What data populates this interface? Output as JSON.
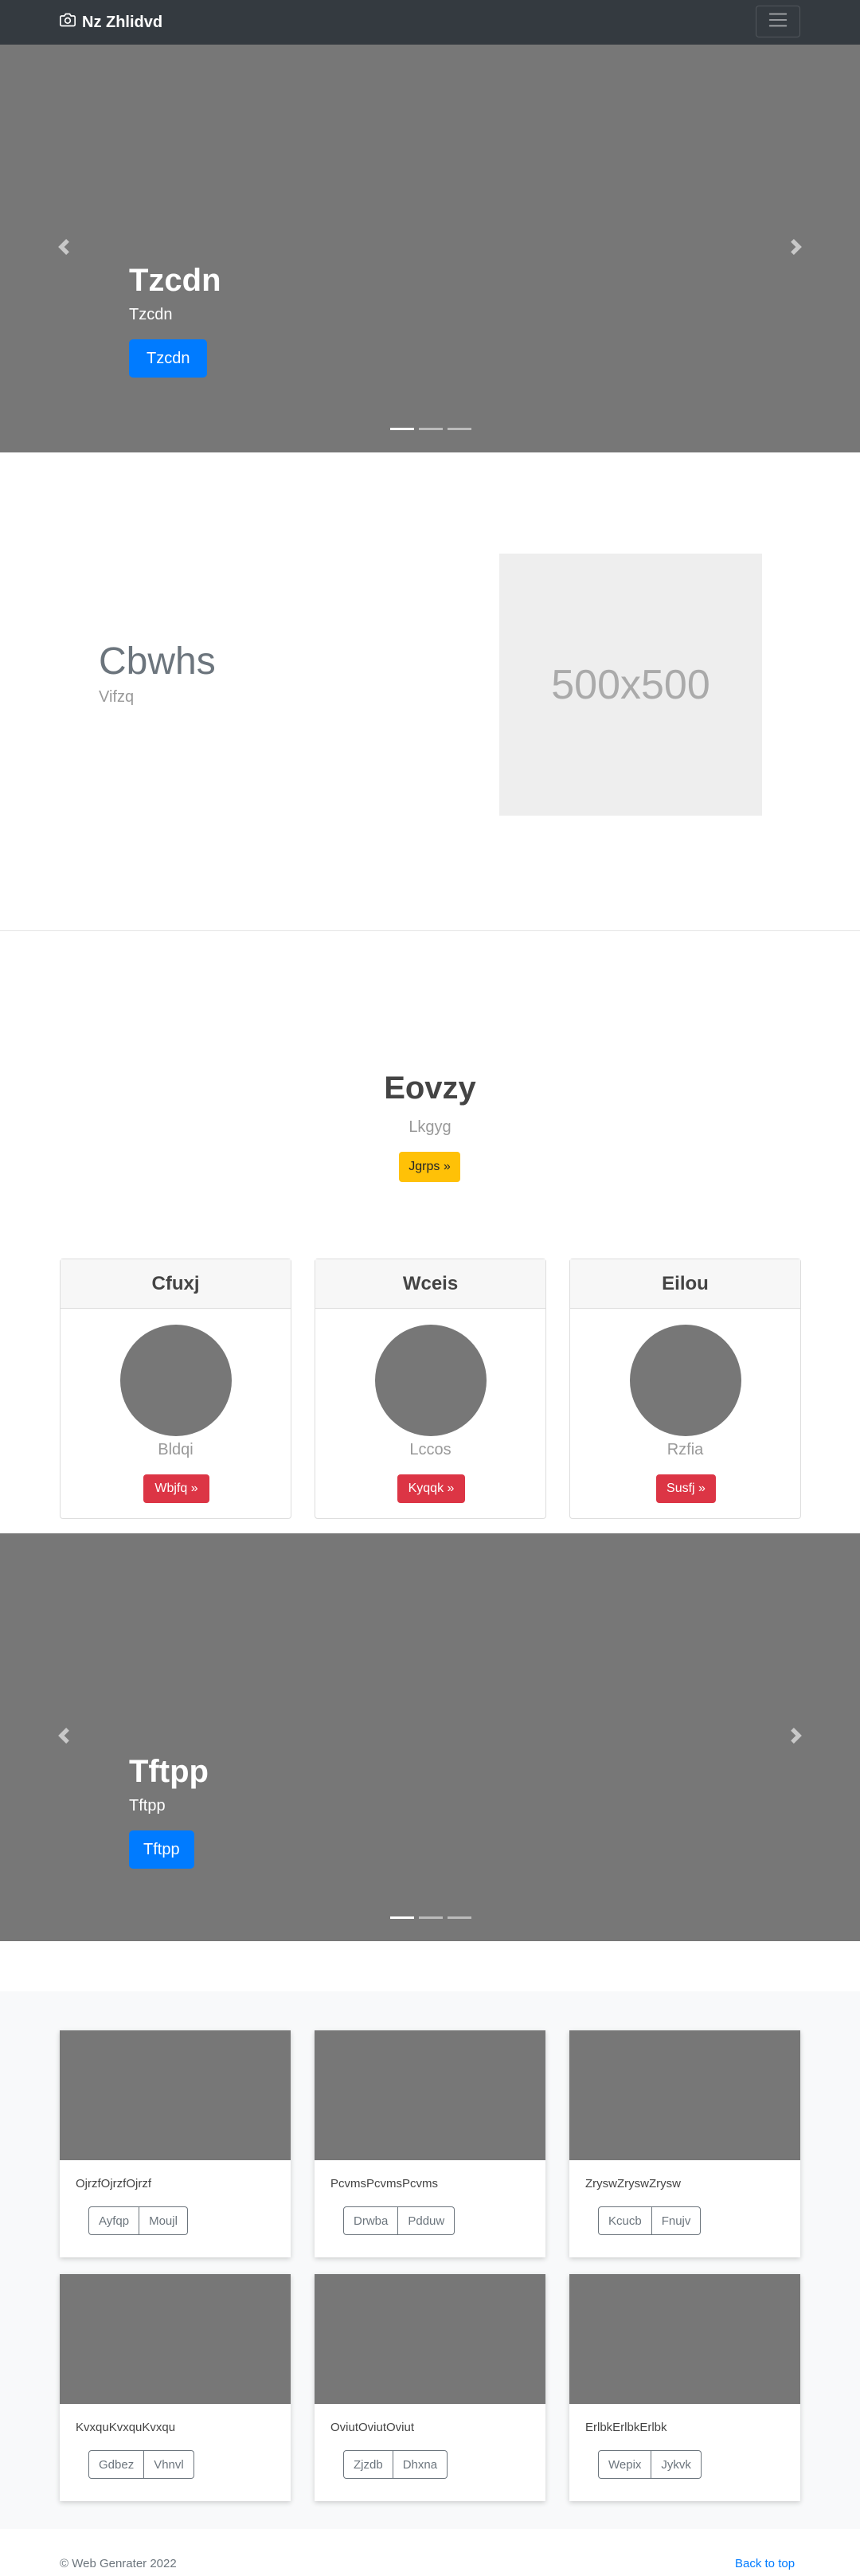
{
  "navbar": {
    "brand": "Nz Zhlidvd"
  },
  "carousel1": {
    "title": "Tzcdn",
    "subtitle": "Tzcdn",
    "button": "Tzcdn"
  },
  "featurette": {
    "heading": "Cbwhs",
    "subtext": "Vifzq",
    "placeholder": "500x500"
  },
  "jumbotron": {
    "title": "Eovzy",
    "subtitle": "Lkgyg",
    "button": "Jgrps »"
  },
  "cards": [
    {
      "header": "Cfuxj",
      "label": "Bldqi",
      "button": "Wbjfq »"
    },
    {
      "header": "Wceis",
      "label": "Lccos",
      "button": "Kyqqk »"
    },
    {
      "header": "Eilou",
      "label": "Rzfia",
      "button": "Susfj »"
    }
  ],
  "carousel2": {
    "title": "Tftpp",
    "subtitle": "Tftpp",
    "button": "Tftpp"
  },
  "album": [
    {
      "text": "OjrzfOjrzfOjrzf",
      "btn1": "Ayfqp",
      "btn2": "Moujl"
    },
    {
      "text": "PcvmsPcvmsPcvms",
      "btn1": "Drwba",
      "btn2": "Pdduw"
    },
    {
      "text": "ZryswZryswZrysw",
      "btn1": "Kcucb",
      "btn2": "Fnujv"
    },
    {
      "text": "KvxquKvxquKvxqu",
      "btn1": "Gdbez",
      "btn2": "Vhnvl"
    },
    {
      "text": "OviutOviutOviut",
      "btn1": "Zjzdb",
      "btn2": "Dhxna"
    },
    {
      "text": "ErlbkErlbkErlbk",
      "btn1": "Wepix",
      "btn2": "Jykvk"
    }
  ],
  "footer": {
    "copyright": "© Web Genrater 2022",
    "back_to_top": "Back to top"
  }
}
